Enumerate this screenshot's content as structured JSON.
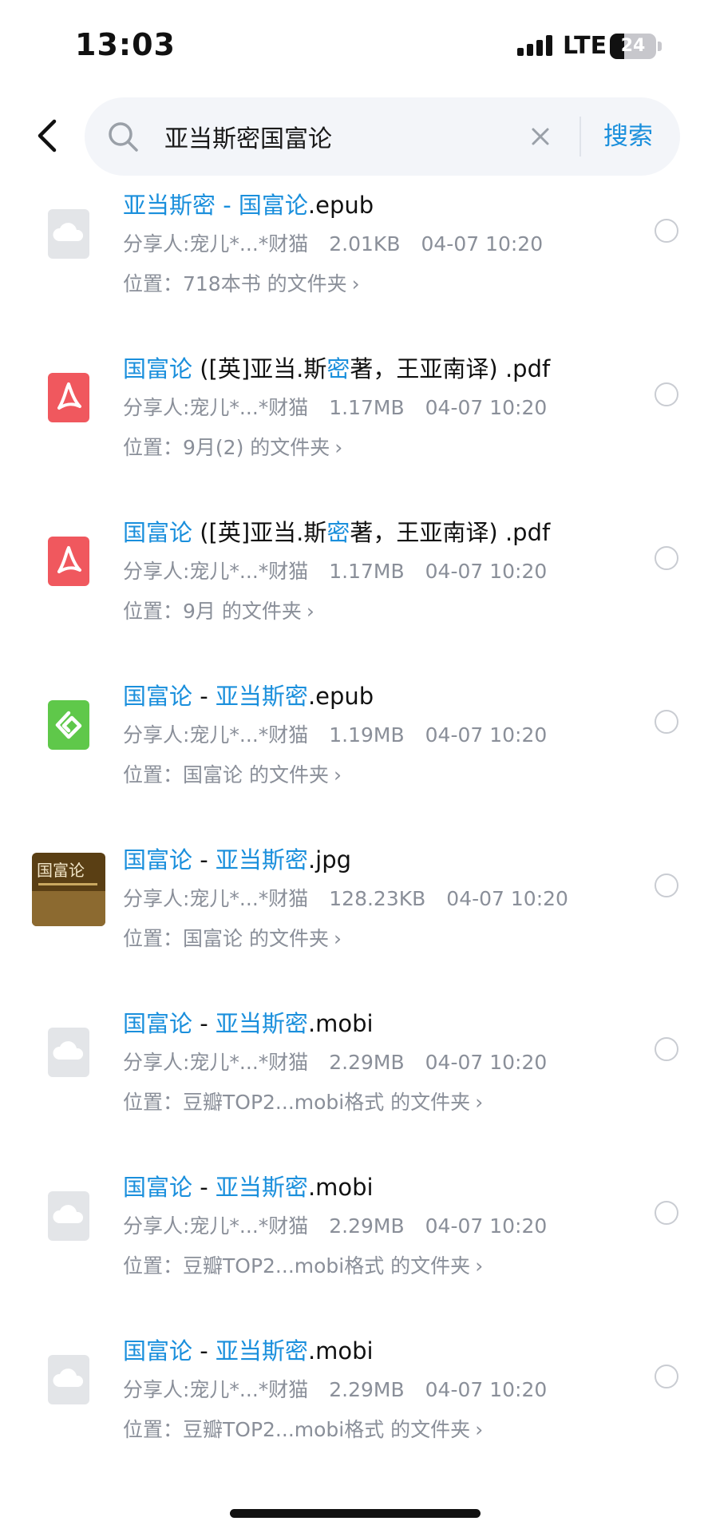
{
  "status_bar": {
    "time": "13:03",
    "network": "LTE",
    "battery": "24"
  },
  "search": {
    "query": "亚当斯密国富论",
    "button_label": "搜索"
  },
  "accent_color": "#1a8fdc",
  "results": [
    {
      "icon": "cloud-file-icon",
      "title_parts": [
        "亚当斯密 - 国富论",
        ".epub"
      ],
      "sharer": "分享人:宠儿*...*财猫",
      "size": "2.01KB",
      "date": "04-07 10:20",
      "location": "位置：718本书 的文件夹"
    },
    {
      "icon": "pdf-icon",
      "title_parts": [
        "国富论",
        " ([英]亚当.斯",
        "密",
        "著，王亚南译) .pdf"
      ],
      "sharer": "分享人:宠儿*...*财猫",
      "size": "1.17MB",
      "date": "04-07 10:20",
      "location": "位置：9月(2) 的文件夹"
    },
    {
      "icon": "pdf-icon",
      "title_parts": [
        "国富论",
        " ([英]亚当.斯",
        "密",
        "著，王亚南译) .pdf"
      ],
      "sharer": "分享人:宠儿*...*财猫",
      "size": "1.17MB",
      "date": "04-07 10:20",
      "location": "位置：9月 的文件夹"
    },
    {
      "icon": "epub-icon",
      "title_parts": [
        "国富论",
        " - ",
        "亚当斯密",
        ".epub"
      ],
      "sharer": "分享人:宠儿*...*财猫",
      "size": "1.19MB",
      "date": "04-07 10:20",
      "location": "位置：国富论 的文件夹"
    },
    {
      "icon": "image-thumbnail-icon",
      "thumb_title": "国富论",
      "title_parts": [
        "国富论",
        " - ",
        "亚当斯密",
        ".jpg"
      ],
      "sharer": "分享人:宠儿*...*财猫",
      "size": "128.23KB",
      "date": "04-07 10:20",
      "location": "位置：国富论 的文件夹"
    },
    {
      "icon": "cloud-file-icon",
      "title_parts": [
        "国富论",
        " - ",
        "亚当斯密",
        ".mobi"
      ],
      "sharer": "分享人:宠儿*...*财猫",
      "size": "2.29MB",
      "date": "04-07 10:20",
      "location": "位置：豆瓣TOP2...mobi格式 的文件夹"
    },
    {
      "icon": "cloud-file-icon",
      "title_parts": [
        "国富论",
        " - ",
        "亚当斯密",
        ".mobi"
      ],
      "sharer": "分享人:宠儿*...*财猫",
      "size": "2.29MB",
      "date": "04-07 10:20",
      "location": "位置：豆瓣TOP2...mobi格式 的文件夹"
    },
    {
      "icon": "cloud-file-icon",
      "title_parts": [
        "国富论",
        " - ",
        "亚当斯密",
        ".mobi"
      ],
      "sharer": "分享人:宠儿*...*财猫",
      "size": "2.29MB",
      "date": "04-07 10:20",
      "location": "位置：豆瓣TOP2...mobi格式 的文件夹"
    }
  ],
  "chevron": "›"
}
